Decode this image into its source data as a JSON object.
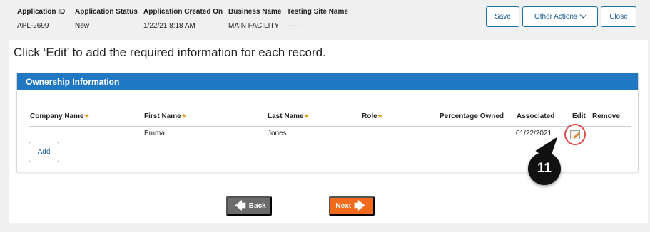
{
  "header": {
    "fields": [
      {
        "label": "Application ID",
        "value": "APL-2699"
      },
      {
        "label": "Application Status",
        "value": "New"
      },
      {
        "label": "Application Created On",
        "value": "1/22/21 8:18 AM"
      },
      {
        "label": "Business Name",
        "value": "MAIN FACILITY"
      },
      {
        "label": "Testing Site Name",
        "value": "——"
      }
    ],
    "buttons": {
      "save": "Save",
      "other_actions": "Other Actions",
      "close": "Close"
    }
  },
  "instruction": "Click ‘Edit’ to add the required information for each record.",
  "ownership": {
    "title": "Ownership Information",
    "columns": [
      {
        "label": "Company Name",
        "required": true
      },
      {
        "label": "First Name",
        "required": true
      },
      {
        "label": "Last Name",
        "required": true
      },
      {
        "label": "Role",
        "required": true
      },
      {
        "label": "Percentage Owned",
        "required": false
      },
      {
        "label": "Associated",
        "required": false
      },
      {
        "label": "Edit",
        "required": false
      },
      {
        "label": "Remove",
        "required": false
      }
    ],
    "rows": [
      {
        "company": "",
        "first": "Emma",
        "last": "Jones",
        "role": "",
        "percentage": "",
        "associated": "01/22/2021"
      }
    ],
    "add_label": "Add",
    "required_marker": "★"
  },
  "callout": "11",
  "nav": {
    "back": "Back",
    "next": "Next"
  },
  "colors": {
    "accent": "#1f78c1",
    "next": "#f26a1b",
    "back": "#6b6b6b",
    "highlight": "#e24b4b"
  }
}
